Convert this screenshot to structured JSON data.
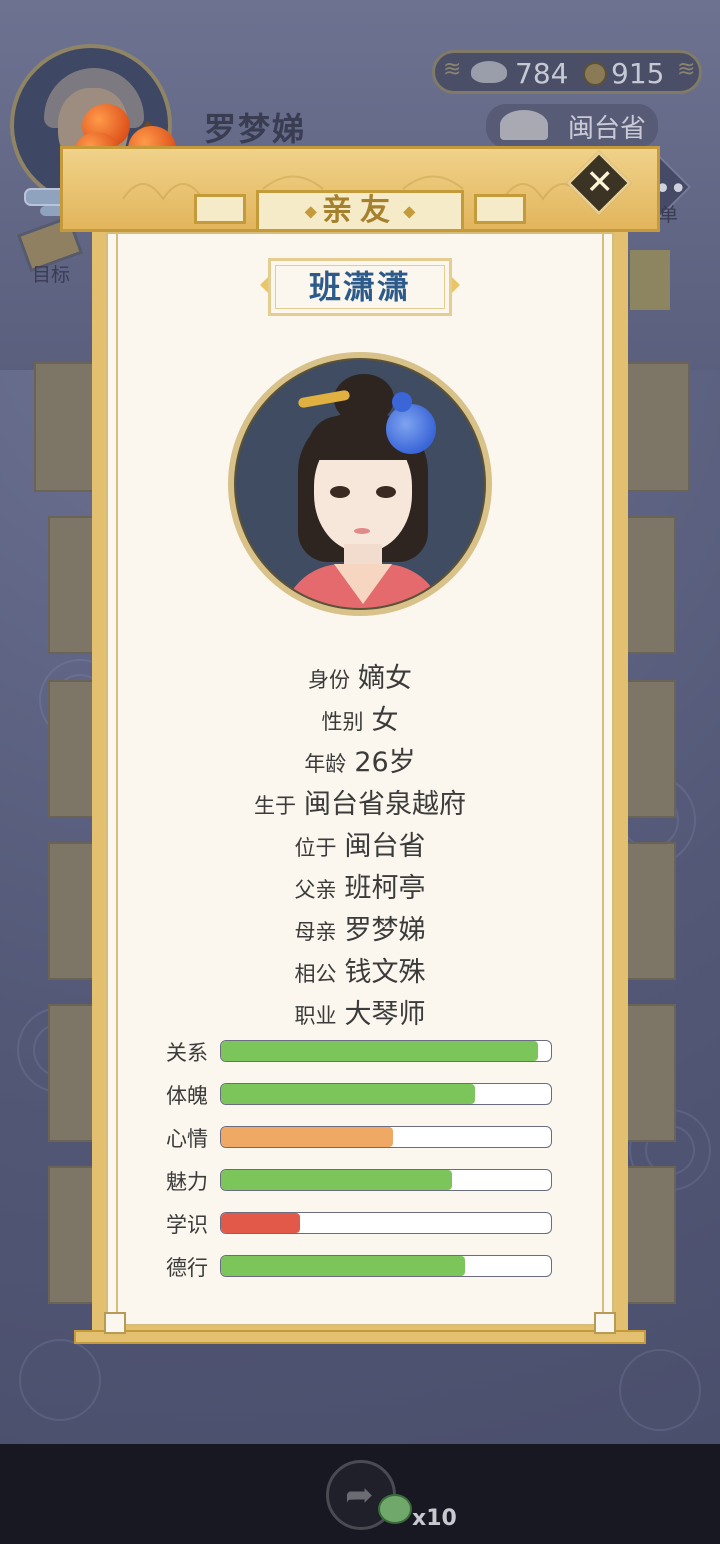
{
  "player": {
    "name": "罗梦娣",
    "goal_label": "目标"
  },
  "currency": {
    "silver": "784",
    "copper": "915"
  },
  "region": {
    "label": "闽台省"
  },
  "menu": {
    "label": "菜单"
  },
  "modal": {
    "title": "亲友",
    "close_icon": "✕",
    "character": {
      "name": "班潇潇",
      "details": [
        {
          "label": "身份",
          "value": "嫡女"
        },
        {
          "label": "性别",
          "value": "女"
        },
        {
          "label": "年龄",
          "value": "26岁"
        },
        {
          "label": "生于",
          "value": "闽台省泉越府"
        },
        {
          "label": "位于",
          "value": "闽台省"
        },
        {
          "label": "父亲",
          "value": "班柯亭"
        },
        {
          "label": "母亲",
          "value": "罗梦娣"
        },
        {
          "label": "相公",
          "value": "钱文殊"
        },
        {
          "label": "职业",
          "value": "大琴师"
        }
      ],
      "stats": [
        {
          "label": "关系",
          "value": 0.96,
          "color": "#7bc55a"
        },
        {
          "label": "体魄",
          "value": 0.77,
          "color": "#7bc55a"
        },
        {
          "label": "心情",
          "value": 0.52,
          "color": "#f0a865"
        },
        {
          "label": "魅力",
          "value": 0.7,
          "color": "#7bc55a"
        },
        {
          "label": "学识",
          "value": 0.24,
          "color": "#e2594a"
        },
        {
          "label": "德行",
          "value": 0.74,
          "color": "#7bc55a"
        }
      ]
    }
  },
  "bottom": {
    "reward_count": "x10"
  }
}
